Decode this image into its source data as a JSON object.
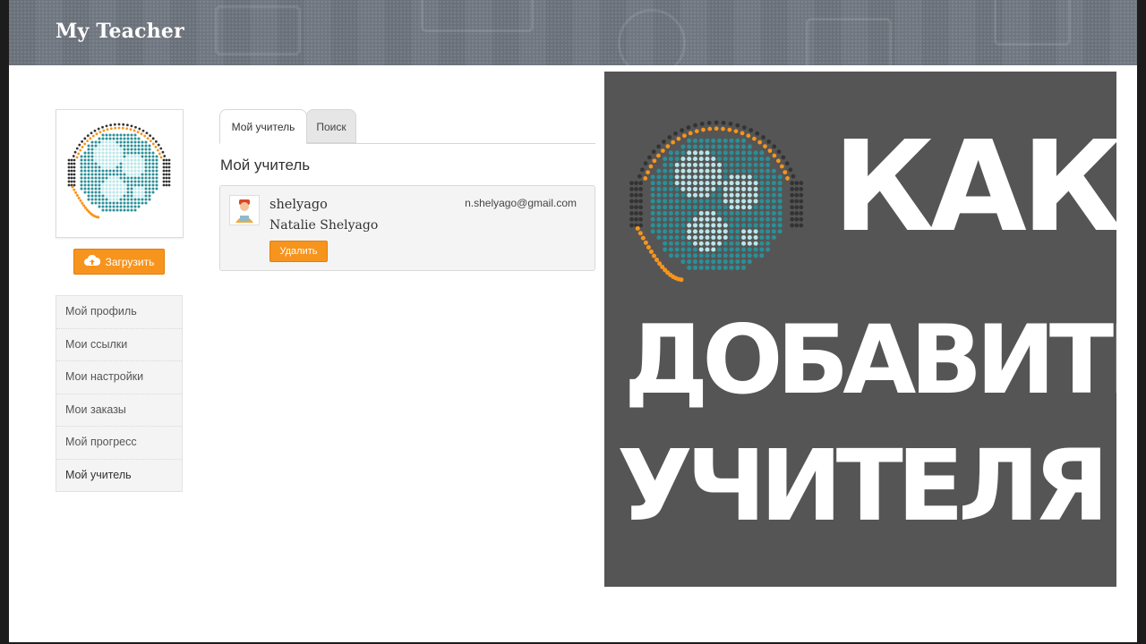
{
  "header": {
    "brand": "My Teacher"
  },
  "profile": {
    "upload_label": "Загрузить"
  },
  "side_menu": {
    "items": [
      {
        "label": "Мой профиль"
      },
      {
        "label": "Мои ссылки"
      },
      {
        "label": "Мои настройки"
      },
      {
        "label": "Мои заказы"
      },
      {
        "label": "Мой прогресс"
      },
      {
        "label": "Мой учитель"
      }
    ],
    "active": "Мой учитель"
  },
  "tabs": [
    {
      "label": "Мой учитель",
      "active": true
    },
    {
      "label": "Поиск",
      "active": false
    }
  ],
  "section_title": "Мой учитель",
  "teacher": {
    "username": "shelyago",
    "full_name": "Natalie Shelyago",
    "email": "n.shelyago@gmail.com",
    "delete_label": "Удалить"
  },
  "promo": {
    "lines": [
      "КАК",
      "ДОБАВИТЬ",
      "УЧИТЕЛЯ"
    ]
  },
  "colors": {
    "accent": "#f7941d",
    "header_bg": "#6f7680",
    "promo_bg": "#555555",
    "globe": "#2a8f98",
    "globe_light": "#b8e6ea"
  },
  "icons": {
    "logo": "globe-headset-icon",
    "upload": "cloud-upload-icon",
    "teacher_avatar": "teacher-person-icon"
  }
}
